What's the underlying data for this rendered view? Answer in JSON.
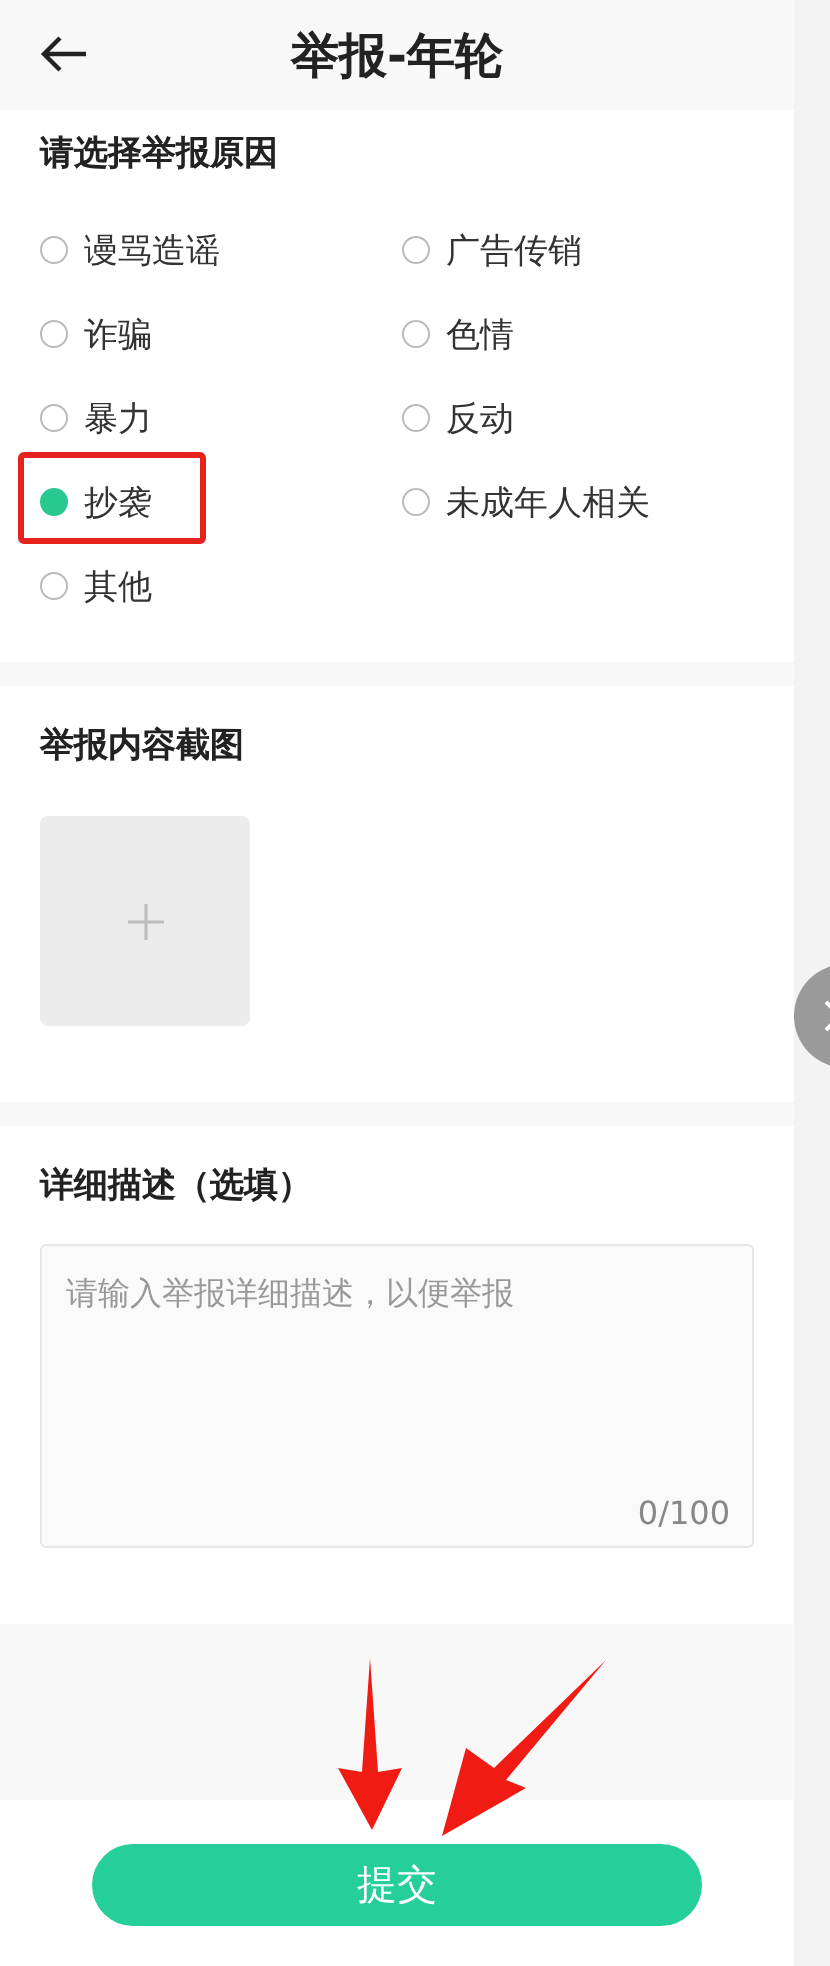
{
  "header": {
    "title": "举报-年轮"
  },
  "reasons": {
    "title": "请选择举报原因",
    "options": [
      {
        "label": "谩骂造谣",
        "selected": false
      },
      {
        "label": "广告传销",
        "selected": false
      },
      {
        "label": "诈骗",
        "selected": false
      },
      {
        "label": "色情",
        "selected": false
      },
      {
        "label": "暴力",
        "selected": false
      },
      {
        "label": "反动",
        "selected": false
      },
      {
        "label": "抄袭",
        "selected": true
      },
      {
        "label": "未成年人相关",
        "selected": false
      },
      {
        "label": "其他",
        "selected": false
      }
    ]
  },
  "screenshot": {
    "title": "举报内容截图"
  },
  "description": {
    "title": "详细描述（选填）",
    "placeholder": "请输入举报详细描述，以便举报",
    "counter": "0/100"
  },
  "submit": {
    "label": "提交"
  }
}
